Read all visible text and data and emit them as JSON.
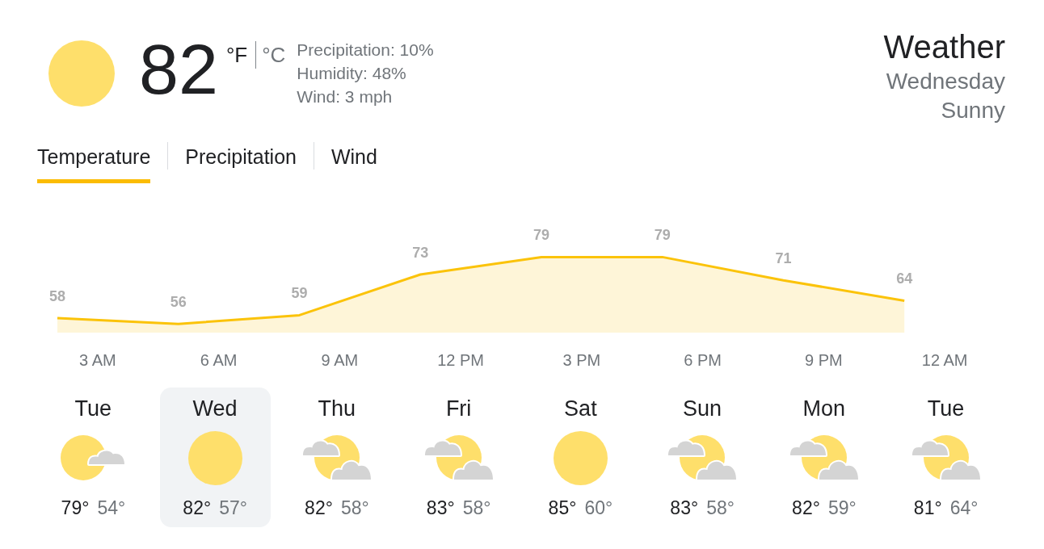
{
  "current": {
    "kind": "sunny",
    "temperature": "82",
    "units": [
      {
        "label": "°F",
        "selected": true
      },
      {
        "label": "°C",
        "selected": false
      }
    ],
    "details": [
      "Precipitation: 10%",
      "Humidity: 48%",
      "Wind: 3 mph"
    ]
  },
  "header": {
    "title": "Weather",
    "day": "Wednesday",
    "condition": "Sunny"
  },
  "tabs": [
    {
      "label": "Temperature",
      "selected": true
    },
    {
      "label": "Precipitation",
      "selected": false
    },
    {
      "label": "Wind",
      "selected": false
    }
  ],
  "chart": {
    "chart_data": {
      "type": "area",
      "categories": [
        null,
        "3 AM",
        null,
        null,
        "6 AM",
        null,
        null,
        "9 AM",
        null,
        null,
        "12 PM",
        null,
        null,
        "3 PM",
        null,
        null,
        "6 PM",
        null,
        null,
        "9 PM",
        null,
        null,
        "12 AM",
        null
      ],
      "series": [
        {
          "color": "#fbc30a",
          "values": [
            58,
            null,
            null,
            56,
            null,
            null,
            59,
            null,
            null,
            73,
            null,
            null,
            79,
            null,
            null,
            79,
            null,
            null,
            71,
            null,
            null,
            64,
            null,
            null
          ]
        }
      ],
      "data_labels": true
    }
  },
  "days": [
    {
      "day": "Tue",
      "kind": "mostly_sunny",
      "high": "79°",
      "low": "54°",
      "selected": false
    },
    {
      "day": "Wed",
      "kind": "sunny",
      "high": "82°",
      "low": "57°",
      "selected": true
    },
    {
      "day": "Thu",
      "kind": "partly_cloudy",
      "high": "82°",
      "low": "58°",
      "selected": false
    },
    {
      "day": "Fri",
      "kind": "partly_cloudy",
      "high": "83°",
      "low": "58°",
      "selected": false
    },
    {
      "day": "Sat",
      "kind": "sunny",
      "high": "85°",
      "low": "60°",
      "selected": false
    },
    {
      "day": "Sun",
      "kind": "partly_cloudy",
      "high": "83°",
      "low": "58°",
      "selected": false
    },
    {
      "day": "Mon",
      "kind": "partly_cloudy",
      "high": "82°",
      "low": "59°",
      "selected": false
    },
    {
      "day": "Tue",
      "kind": "partly_cloudy",
      "high": "81°",
      "low": "64°",
      "selected": false
    }
  ]
}
